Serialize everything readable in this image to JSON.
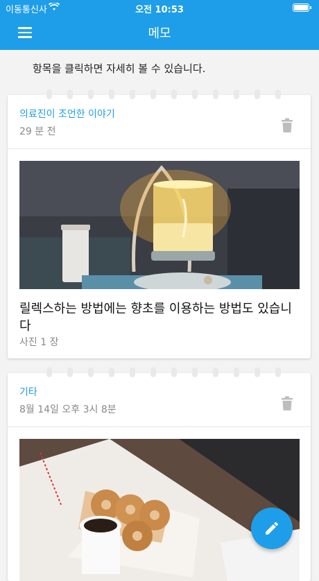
{
  "status_bar": {
    "carrier": "이동통신사",
    "time": "오전 10:53"
  },
  "app_bar": {
    "title": "메모"
  },
  "hint": "항목을 클릭하면 자세히 볼 수 있습니다.",
  "notes": [
    {
      "category": "의료진이 조언한 이야기",
      "date": "29 분 전",
      "photo": "candle-lantern",
      "body": "릴렉스하는 방법에는 향초를 이용하는 방법도 있습니다",
      "photo_count": "사진 1 장"
    },
    {
      "category": "기타",
      "date": "8월 14일 오후 3시 8분",
      "photo": "donuts-and-coffee"
    }
  ],
  "icons": {
    "menu": "menu-icon",
    "trash": "trash-icon",
    "fab": "pencil-icon",
    "wifi": "wifi-icon",
    "battery": "battery-icon"
  },
  "colors": {
    "primary": "#1e9ee8",
    "category": "#1e9ee8",
    "muted": "#888888"
  }
}
